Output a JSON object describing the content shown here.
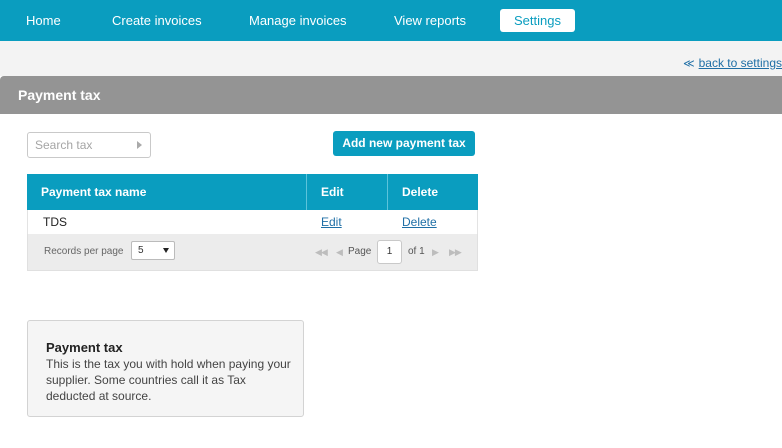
{
  "nav": {
    "items": [
      {
        "label": "Home"
      },
      {
        "label": "Create invoices"
      },
      {
        "label": "Manage invoices"
      },
      {
        "label": "View reports"
      },
      {
        "label": "Settings",
        "active": true
      }
    ]
  },
  "back_link": {
    "icon": "double-chevron-left-icon",
    "label": "back to settings"
  },
  "page": {
    "title": "Payment tax"
  },
  "search": {
    "placeholder": "Search tax"
  },
  "add_button": {
    "label": "Add new payment tax"
  },
  "table": {
    "columns": [
      "Payment tax name",
      "Edit",
      "Delete"
    ],
    "rows": [
      {
        "name": "TDS",
        "edit": "Edit",
        "delete": "Delete"
      }
    ]
  },
  "pager": {
    "records_per_page_label": "Records per page",
    "records_per_page_value": "5",
    "page_label": "Page",
    "page_value": "1",
    "of_label": "of 1"
  },
  "info": {
    "title": "Payment tax",
    "text": "This is the tax you with hold when paying your supplier. Some countries call it as Tax deducted at source."
  },
  "colors": {
    "accent": "#0a9dbf",
    "header_bar": "#949494",
    "link": "#1f6fa6"
  }
}
